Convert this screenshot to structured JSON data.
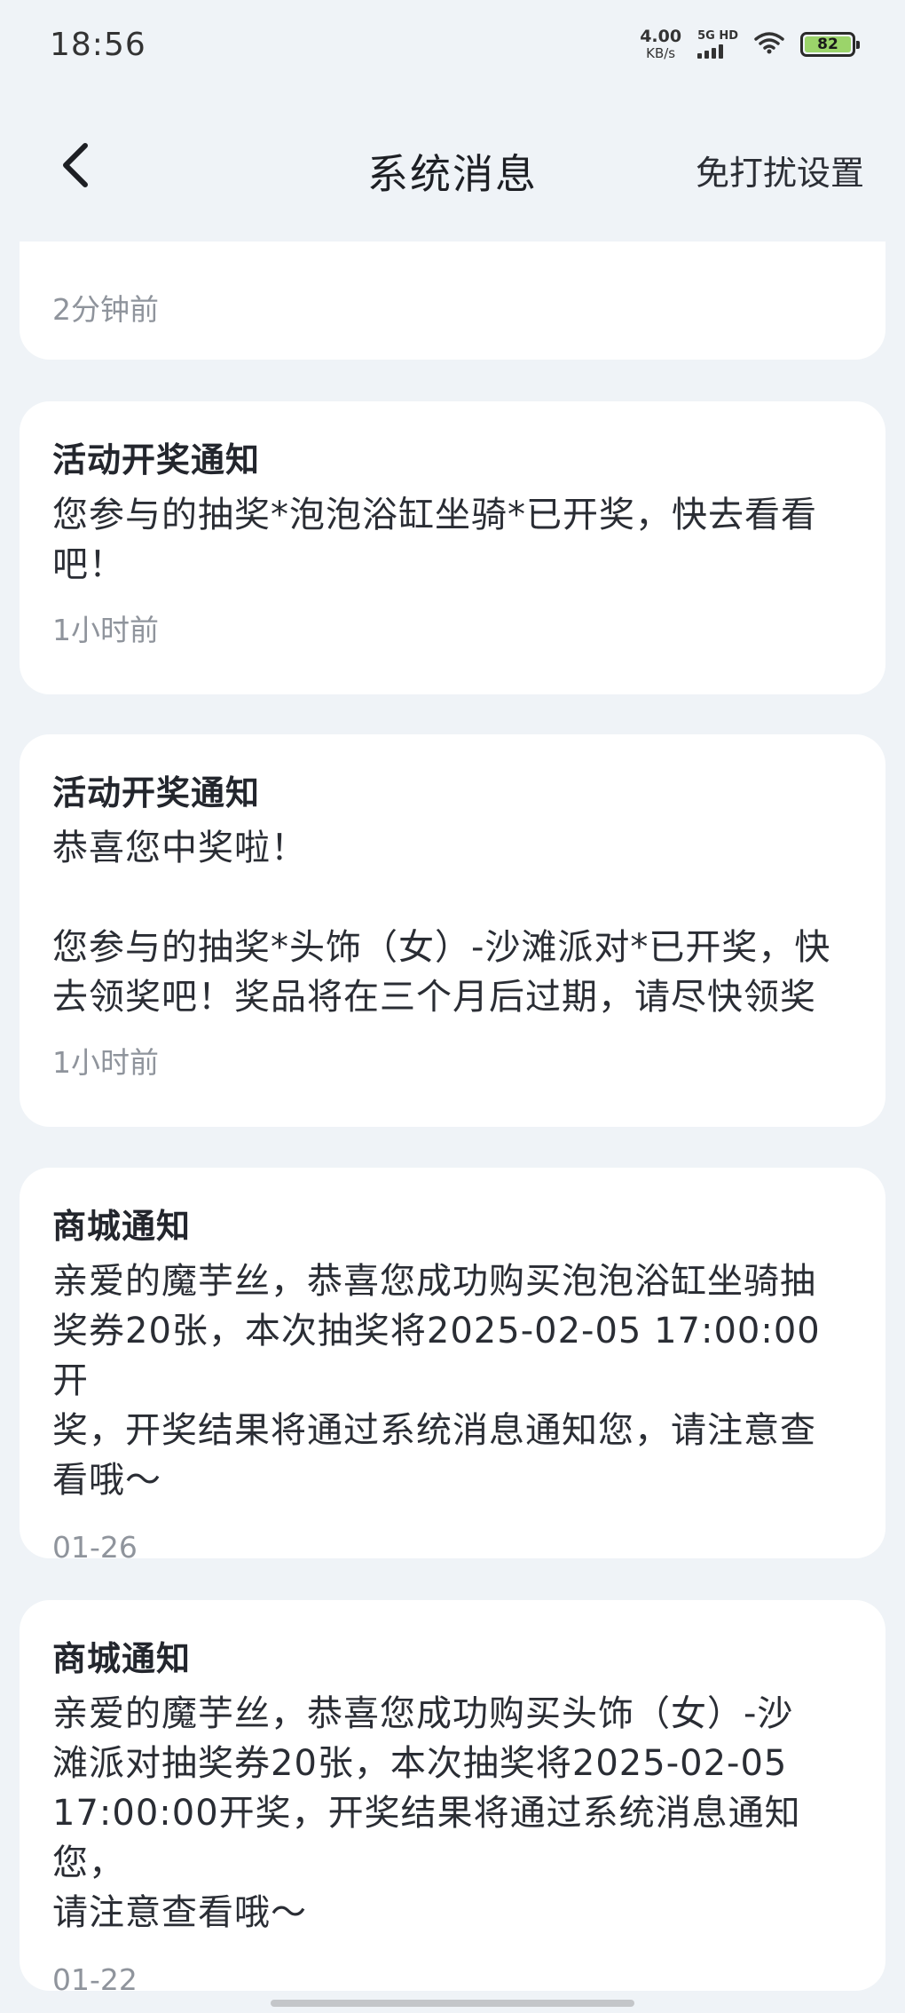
{
  "status_bar": {
    "time": "18:56",
    "net_speed": "4.00",
    "net_speed_unit": "KB/s",
    "network_type": "5G HD",
    "battery_level": "82"
  },
  "header": {
    "title": "系统消息",
    "right_action": "免打扰设置",
    "back_icon": "chevron-left-icon"
  },
  "messages": [
    {
      "title": "",
      "body": "",
      "time": "2分钟前"
    },
    {
      "title": "活动开奖通知",
      "body": "您参与的抽奖*泡泡浴缸坐骑*已开奖，快去看看\n吧！",
      "time": "1小时前"
    },
    {
      "title": "活动开奖通知",
      "body": "恭喜您中奖啦！\n\n您参与的抽奖*头饰（女）-沙滩派对*已开奖，快\n去领奖吧！奖品将在三个月后过期，请尽快领奖",
      "time": "1小时前"
    },
    {
      "title": "商城通知",
      "body": "亲爱的魔芋丝，恭喜您成功购买泡泡浴缸坐骑抽\n奖券20张，本次抽奖将2025-02-05 17:00:00开\n奖，开奖结果将通过系统消息通知您，请注意查\n看哦～",
      "time": "01-26"
    },
    {
      "title": "商城通知",
      "body": "亲爱的魔芋丝，恭喜您成功购买头饰（女）-沙\n滩派对抽奖券20张，本次抽奖将2025-02-05\n17:00:00开奖，开奖结果将通过系统消息通知您，\n请注意查看哦～",
      "time": "01-22"
    }
  ],
  "colors": {
    "background": "#eff3f7",
    "card": "#ffffff",
    "time_text": "#8f949c"
  }
}
